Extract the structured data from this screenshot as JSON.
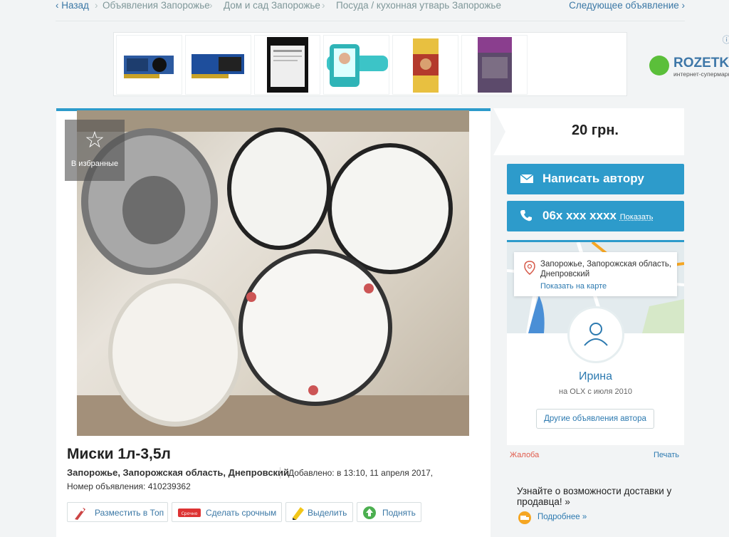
{
  "breadcrumbs": {
    "back_label": "Назад",
    "items": [
      "Объявления Запорожье",
      "Дом и сад Запорожье",
      "Посуда / кухонная утварь Запорожье"
    ],
    "next_label": "Следующее объявление"
  },
  "ad_banner": {
    "brand": "ROZETKA",
    "brand_sub": "интернет-супермаркет"
  },
  "listing": {
    "favorite_label": "В избранные",
    "title": "Миски 1л-3,5л",
    "location": "Запорожье, Запорожская область, Днепровский",
    "added": "Добавлено: в 13:10, 11 апреля 2017,",
    "ad_number": "Номер объявления: 410239362",
    "actions": [
      "Разместить в Топ",
      "Сделать срочным",
      "Выделить",
      "Поднять"
    ]
  },
  "sidebar": {
    "price": "20 грн.",
    "message_button": "Написать автору",
    "phone": "06x xxx xxxx",
    "phone_show": "Показать",
    "address": "Запорожье, Запорожская область, Днепровский",
    "map_link": "Показать на карте",
    "user_name": "Ирина",
    "user_since": "на OLX с июля 2010",
    "other_ads_button": "Другие объявления автора",
    "complaint": "Жалоба",
    "print": "Печать",
    "delivery_text": "Узнайте о возможности доставки у продавца! »",
    "delivery_more": "Подробнее »"
  },
  "colors": {
    "accent": "#2d9bcb",
    "link": "#2d7ab0",
    "complaint": "#e05a4b",
    "page_bg": "#f2f4f5"
  }
}
